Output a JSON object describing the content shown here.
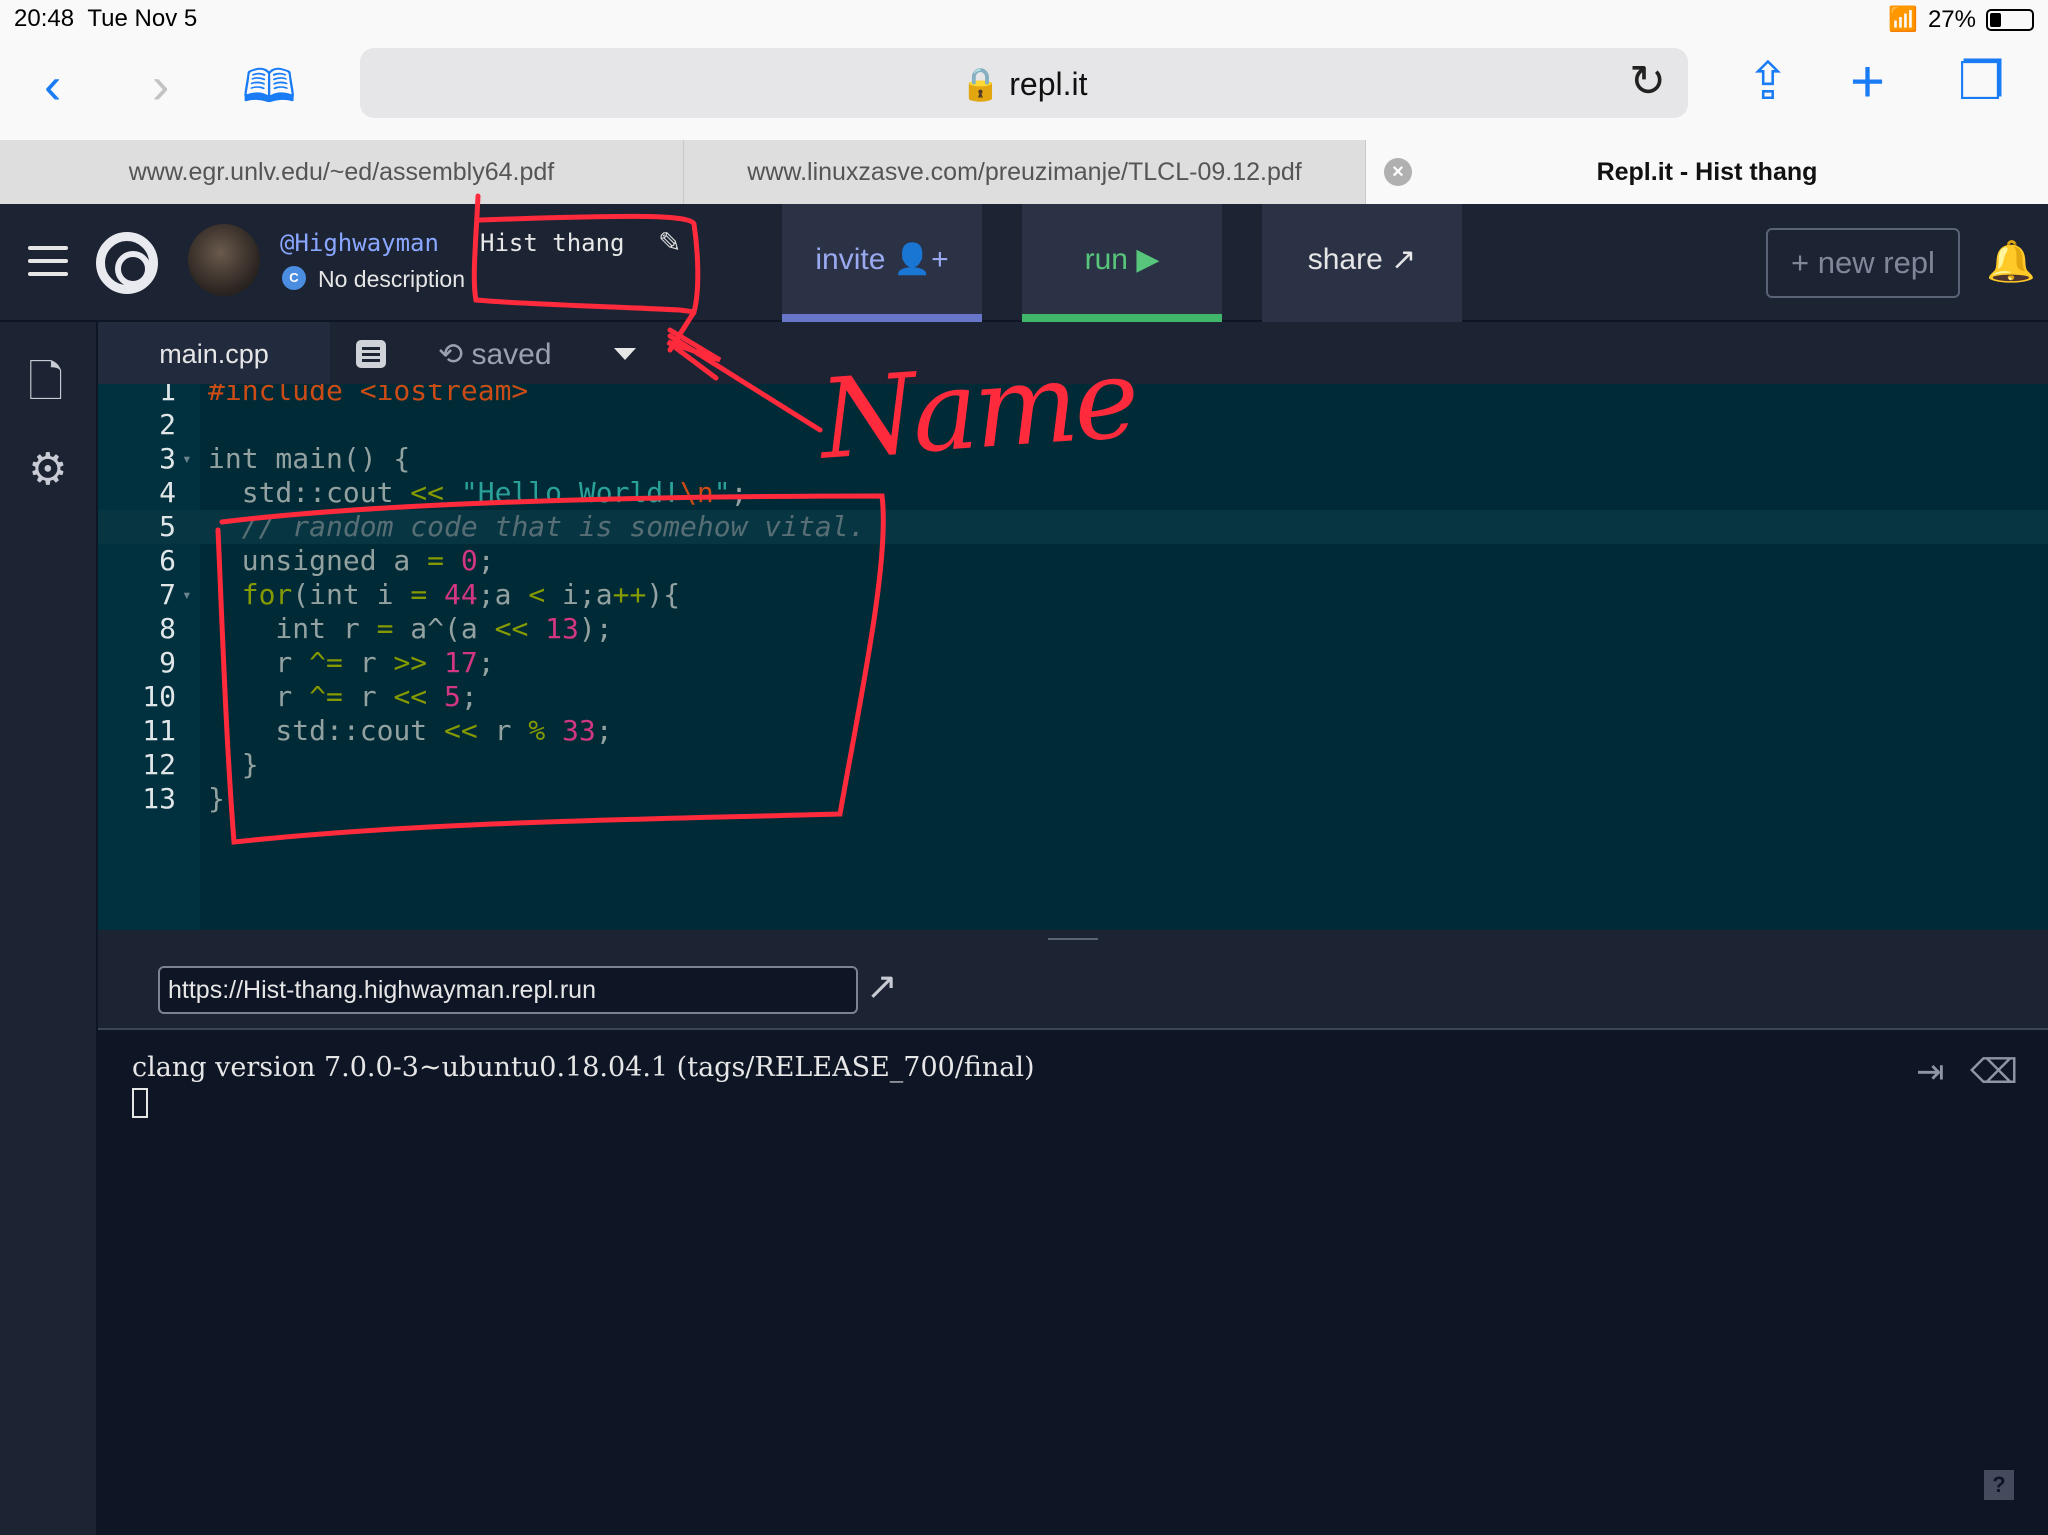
{
  "status_bar": {
    "time": "20:48",
    "date": "Tue Nov 5",
    "battery": "27%"
  },
  "safari": {
    "address": "repl.it",
    "tabs": [
      {
        "label": "www.egr.unlv.edu/~ed/assembly64.pdf",
        "active": false
      },
      {
        "label": "www.linuxzasve.com/preuzimanje/TLCL-09.12.pdf",
        "active": false
      },
      {
        "label": "Repl.it - Hist thang",
        "active": true
      }
    ]
  },
  "header": {
    "username": "@Highwayman",
    "repl_title": "Hist thang",
    "description": "No description",
    "invite_label": "invite",
    "run_label": "run",
    "share_label": "share",
    "new_repl_label": "new repl"
  },
  "editor": {
    "tab_label": "main.cpp",
    "saved_label": "saved",
    "line_numbers": [
      "1",
      "2",
      "3",
      "4",
      "5",
      "6",
      "7",
      "8",
      "9",
      "10",
      "11",
      "12",
      "13"
    ]
  },
  "output": {
    "url": "https://Hist-thang.highwayman.repl.run",
    "console_text": "clang version 7.0.0-3~ubuntu0.18.04.1 (tags/RELEASE_700/final)"
  },
  "annotation": {
    "label": "Name",
    "color": "#ff2a3c"
  },
  "colors": {
    "run": "#3fb66a",
    "invite": "#6876c9",
    "editor_bg": "#002b36",
    "header_bg": "#1c2333"
  }
}
